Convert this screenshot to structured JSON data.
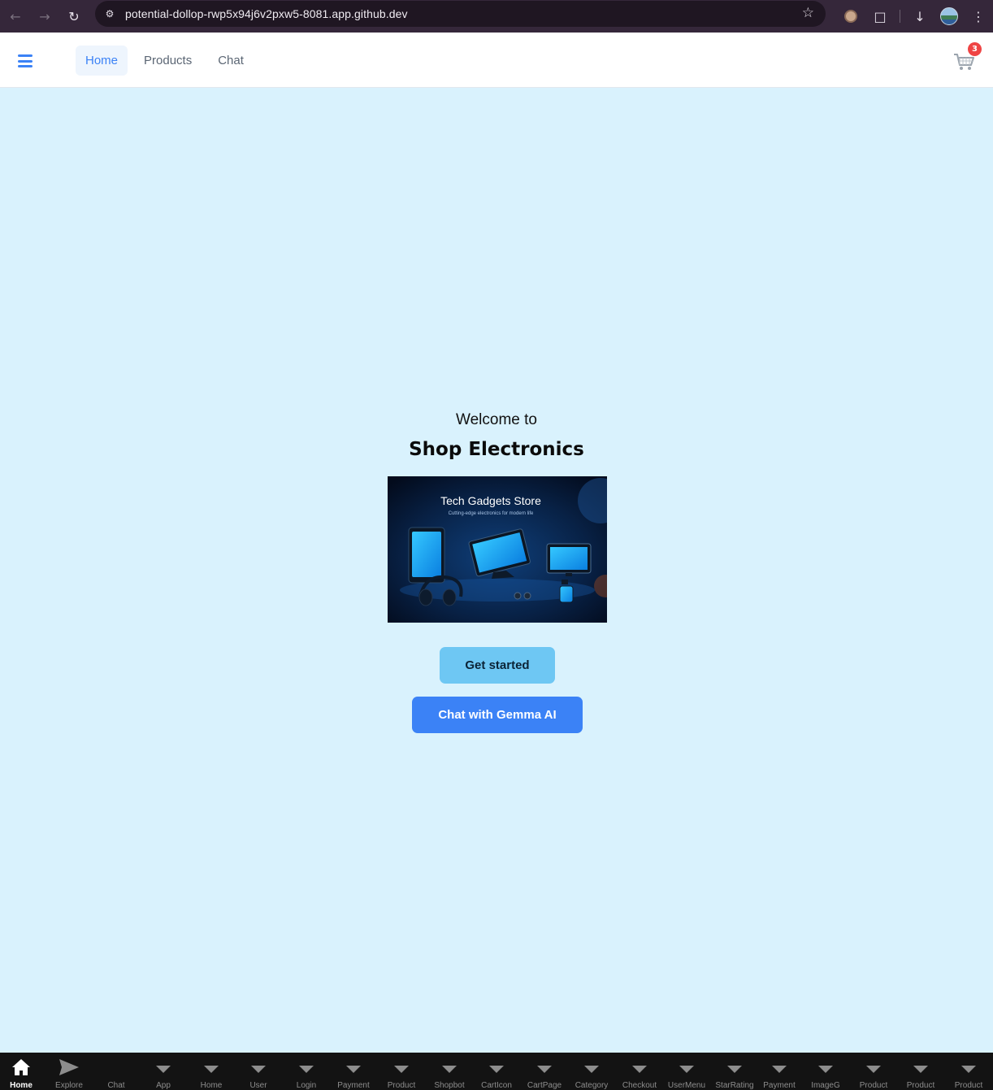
{
  "browser": {
    "url": "potential-dollop-rwp5x94j6v2pxw5-8081.app.github.dev",
    "icons": [
      "back-icon",
      "forward-icon",
      "reload-icon",
      "site-info-icon",
      "bookmark-star-icon",
      "extension-icon",
      "puzzle-icon",
      "download-icon",
      "profile-avatar",
      "menu-kebab-icon"
    ]
  },
  "header": {
    "tabs": [
      {
        "label": "Home",
        "active": true
      },
      {
        "label": "Products",
        "active": false
      },
      {
        "label": "Chat",
        "active": false
      }
    ],
    "cart_count": "3"
  },
  "hero": {
    "welcome": "Welcome to",
    "brand": "Shop Electronics",
    "image": {
      "title": "Tech Gadgets Store",
      "subtitle": "Cutting-edge electronics for modern life"
    },
    "get_started": "Get started",
    "chat_button": "Chat with Gemma AI"
  },
  "bottom_tabs": [
    {
      "label": "Home",
      "icon": "home-icon",
      "active": true
    },
    {
      "label": "Explore",
      "icon": "paper-plane-icon"
    },
    {
      "label": "Chat",
      "icon": "none"
    },
    {
      "label": "App",
      "icon": "triangle-down-icon"
    },
    {
      "label": "Home",
      "icon": "triangle-down-icon"
    },
    {
      "label": "User",
      "icon": "triangle-down-icon"
    },
    {
      "label": "Login",
      "icon": "triangle-down-icon"
    },
    {
      "label": "Payment",
      "icon": "triangle-down-icon"
    },
    {
      "label": "Product",
      "icon": "triangle-down-icon"
    },
    {
      "label": "Shopbot",
      "icon": "triangle-down-icon"
    },
    {
      "label": "CartIcon",
      "icon": "triangle-down-icon"
    },
    {
      "label": "CartPage",
      "icon": "triangle-down-icon"
    },
    {
      "label": "Category",
      "icon": "triangle-down-icon"
    },
    {
      "label": "Checkout",
      "icon": "triangle-down-icon"
    },
    {
      "label": "UserMenu",
      "icon": "triangle-down-icon"
    },
    {
      "label": "StarRating",
      "icon": "triangle-down-icon"
    },
    {
      "label": "Payment",
      "icon": "triangle-down-icon"
    },
    {
      "label": "ImageG",
      "icon": "triangle-down-icon"
    },
    {
      "label": "Product",
      "icon": "triangle-down-icon"
    },
    {
      "label": "Product",
      "icon": "triangle-down-icon"
    },
    {
      "label": "Product",
      "icon": "triangle-down-icon"
    }
  ],
  "colors": {
    "page_bg": "#d9f2fd",
    "accent": "#3b82f6",
    "get_started_bg": "#6ec7f3",
    "badge": "#ef4444"
  }
}
